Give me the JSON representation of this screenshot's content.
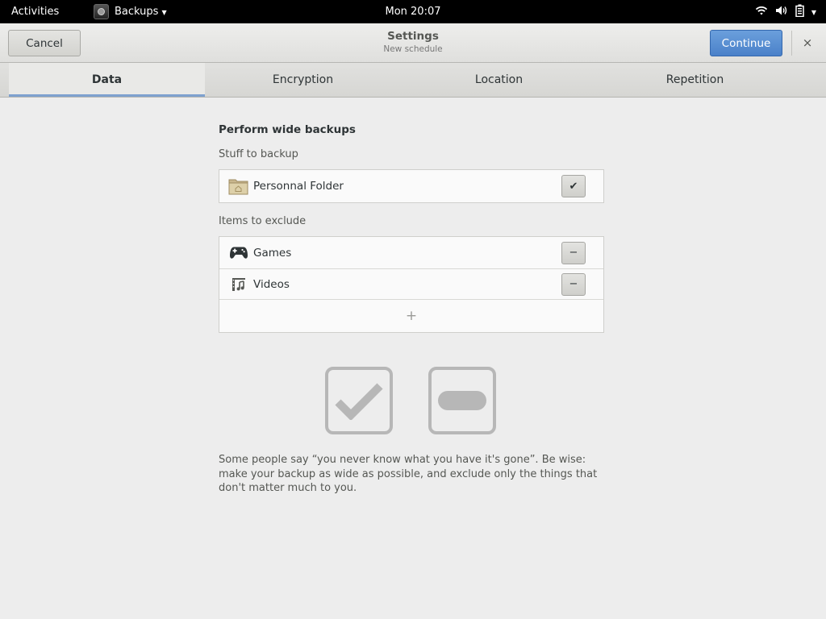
{
  "topbar": {
    "activities": "Activities",
    "app_name": "Backups",
    "clock": "Mon 20:07",
    "tray_icons": [
      "wifi-icon",
      "volume-icon",
      "battery-icon",
      "chevron-down-icon"
    ]
  },
  "headerbar": {
    "cancel_label": "Cancel",
    "title": "Settings",
    "subtitle": "New schedule",
    "continue_label": "Continue",
    "close_glyph": "×"
  },
  "tabs": [
    {
      "label": "Data",
      "active": true
    },
    {
      "label": "Encryption",
      "active": false
    },
    {
      "label": "Location",
      "active": false
    },
    {
      "label": "Repetition",
      "active": false
    }
  ],
  "main": {
    "section_title": "Perform wide backups",
    "include_label": "Stuff to backup",
    "include_items": [
      {
        "label": "Personnal Folder",
        "icon": "home-folder-icon",
        "action_glyph": "✔"
      }
    ],
    "exclude_label": "Items to exclude",
    "exclude_items": [
      {
        "label": "Games",
        "icon": "gamepad-icon",
        "action_glyph": "−"
      },
      {
        "label": "Videos",
        "icon": "video-icon",
        "action_glyph": "−"
      }
    ],
    "add_glyph": "+",
    "help_text": "Some people say “you never know what you have it's gone”. Be wise: make your backup as wide as possible, and exclude only the things that don't matter much to you."
  },
  "colors": {
    "accent": "#4a81c9",
    "tab_underline": "#7ea1cf",
    "topbar_bg": "#000000"
  }
}
